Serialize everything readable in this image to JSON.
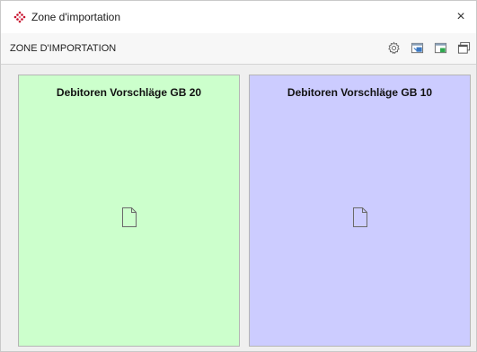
{
  "window": {
    "title": "Zone d'importation",
    "logo_icon": "app-logo-icon",
    "close_glyph": "×"
  },
  "toolbar": {
    "title": "ZONE D'IMPORTATION",
    "icons": [
      "gear-icon",
      "import-window-icon",
      "import-green-icon",
      "window-restore-icon"
    ]
  },
  "colors": {
    "panel_left_bg": "#ccffcc",
    "panel_right_bg": "#ccccff",
    "logo_red": "#c8102e"
  },
  "panels": [
    {
      "title": "Debitoren Vorschläge GB 20",
      "icon": "document-icon"
    },
    {
      "title": "Debitoren Vorschläge GB 10",
      "icon": "document-icon"
    }
  ]
}
